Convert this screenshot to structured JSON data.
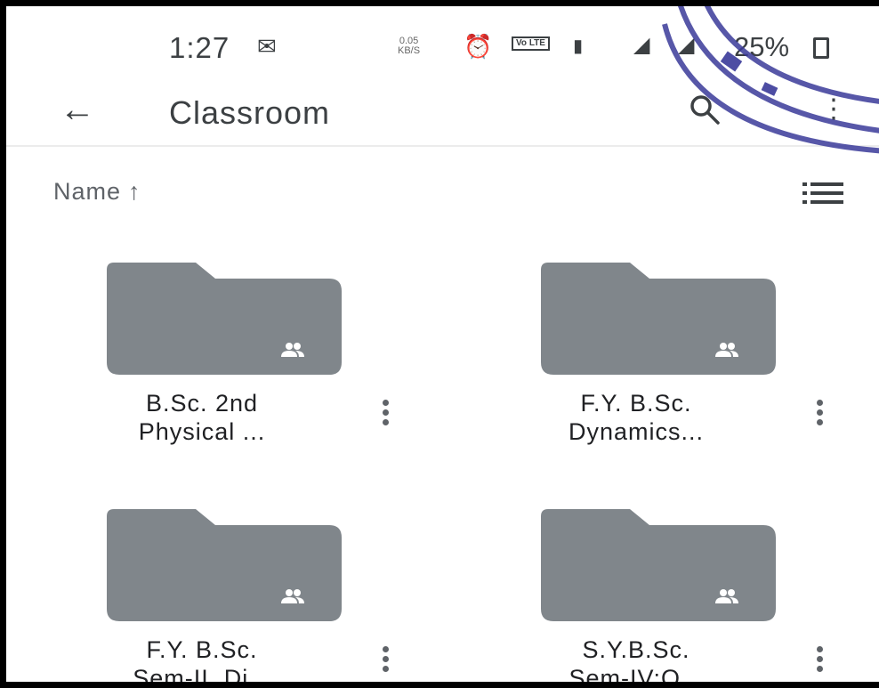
{
  "status_bar": {
    "time": "1:27",
    "net_speed_value": "0.05",
    "net_speed_unit": "KB/S",
    "volte_label": "Vo LTE",
    "battery": "25%",
    "icons": [
      "gmail-icon",
      "alarm-icon",
      "volte-icon",
      "vibrate-icon",
      "signal-icon",
      "battery-icon"
    ]
  },
  "app_bar": {
    "title": "Classroom",
    "back_icon": "arrow-back-icon",
    "search_icon": "search-icon",
    "more_icon": "more-icon"
  },
  "sort": {
    "label": "Name",
    "direction_glyph": "↑",
    "view_toggle_icon": "list-view-icon"
  },
  "folders": [
    {
      "line1": "B.Sc. 2nd",
      "line2": "Physical ...",
      "shared": true
    },
    {
      "line1": "F.Y. B.Sc.",
      "line2": "Dynamics...",
      "shared": true
    },
    {
      "line1": "F.Y. B.Sc.",
      "line2": "Sem-II, Di...",
      "shared": true
    },
    {
      "line1": "S.Y.B.Sc.",
      "line2": "Sem-IV:O...",
      "shared": true
    }
  ],
  "colors": {
    "folder": "#80868b",
    "text": "#3c4043",
    "stamp": "#3a3a9a"
  }
}
